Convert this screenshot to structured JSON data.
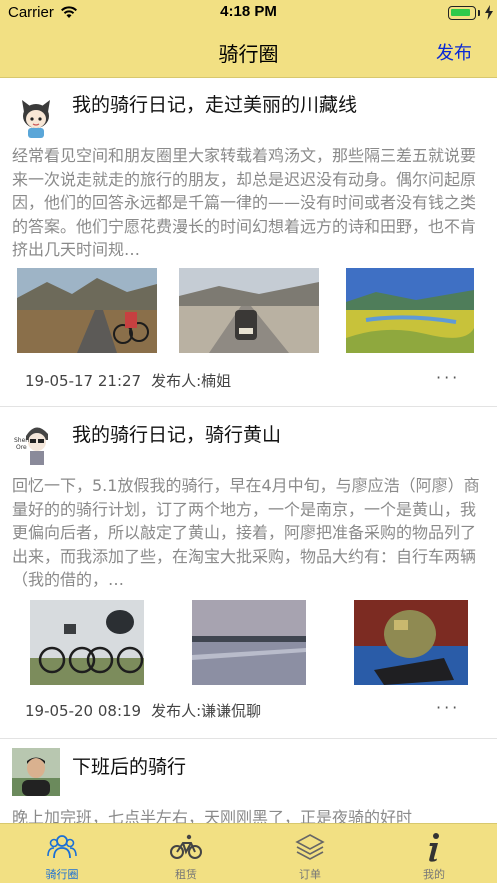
{
  "status_bar": {
    "carrier": "Carrier",
    "time": "4:18 PM",
    "battery_level": 0.85
  },
  "nav": {
    "title": "骑行圈",
    "publish_label": "发布"
  },
  "posts": [
    {
      "title": "我的骑行日记，走过美丽的川藏线",
      "body": "经常看见空间和朋友圈里大家转载着鸡汤文，那些隔三差五就说要来一次说走就走的旅行的朋友，却总是迟迟没有动身。偶尔问起原因，他们的回答永远都是千篇一律的——没有时间或者没有钱之类的答案。他们宁愿花费漫长的时间幻想着远方的诗和田野，也不肯挤出几天时间规…",
      "date": "19-05-17 21:27",
      "author": "发布人:楠姐",
      "more": "···"
    },
    {
      "title": "我的骑行日记，骑行黄山",
      "body": "回忆一下，5.1放假我的骑行，早在4月中旬，与廖应浩（阿廖）商量好的的骑行计划，订了两个地方，一个是南京，一个是黄山，我更偏向后者，所以敲定了黄山，接着，阿廖把准备采购的物品列了出来，而我添加了些，在淘宝大批采购，物品大约有：自行车两辆（我的借的，…",
      "date": "19-05-20 08:19",
      "author": "发布人:谦谦侃聊",
      "more": "···"
    },
    {
      "title": "下班后的骑行",
      "body": "晚上加完班，七点半左右，天刚刚黑了，正是夜骑的好时"
    }
  ],
  "tabs": [
    {
      "label": "骑行圈",
      "icon": "community-icon",
      "active": true
    },
    {
      "label": "租赁",
      "icon": "bicycle-icon",
      "active": false
    },
    {
      "label": "订单",
      "icon": "layers-icon",
      "active": false
    },
    {
      "label": "我的",
      "icon": "info-icon",
      "active": false
    }
  ],
  "colors": {
    "bar_background": "#f2e083",
    "accent_blue": "#0a29d6",
    "active_tab": "#1a6fd6"
  }
}
